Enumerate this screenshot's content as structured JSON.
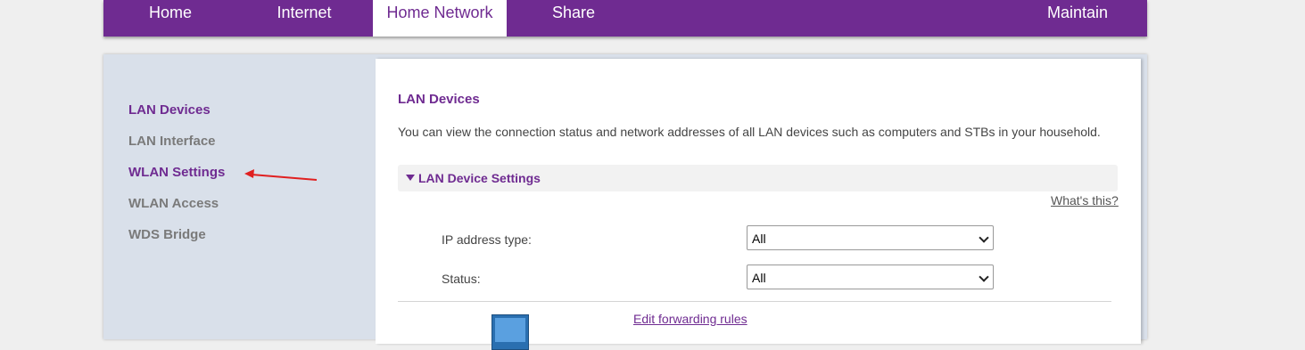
{
  "topnav": {
    "tabs": [
      {
        "label": "Home",
        "active": false
      },
      {
        "label": "Internet",
        "active": false
      },
      {
        "label": "Home Network",
        "active": true
      },
      {
        "label": "Share",
        "active": false
      },
      {
        "label": "Maintain",
        "active": false
      }
    ]
  },
  "sidebar": {
    "items": [
      {
        "label": "LAN Devices",
        "active": true
      },
      {
        "label": "LAN Interface",
        "active": false
      },
      {
        "label": "WLAN Settings",
        "active": true
      },
      {
        "label": "WLAN Access",
        "active": false
      },
      {
        "label": "WDS Bridge",
        "active": false
      }
    ]
  },
  "main": {
    "title": "LAN Devices",
    "description": "You can view the connection status and network addresses of all LAN devices such as computers and STBs in your household.",
    "section": {
      "label": "LAN Device Settings",
      "expanded": true
    },
    "help_link": "What's this?",
    "fields": [
      {
        "label": "IP address type:",
        "value": "All"
      },
      {
        "label": "Status:",
        "value": "All"
      }
    ],
    "device": {
      "icon": "computer-icon",
      "link": "Edit forwarding rules"
    }
  },
  "colors": {
    "brand": "#6f2b91",
    "panel": "#d9e0ea",
    "annotation_arrow": "#e02020"
  }
}
